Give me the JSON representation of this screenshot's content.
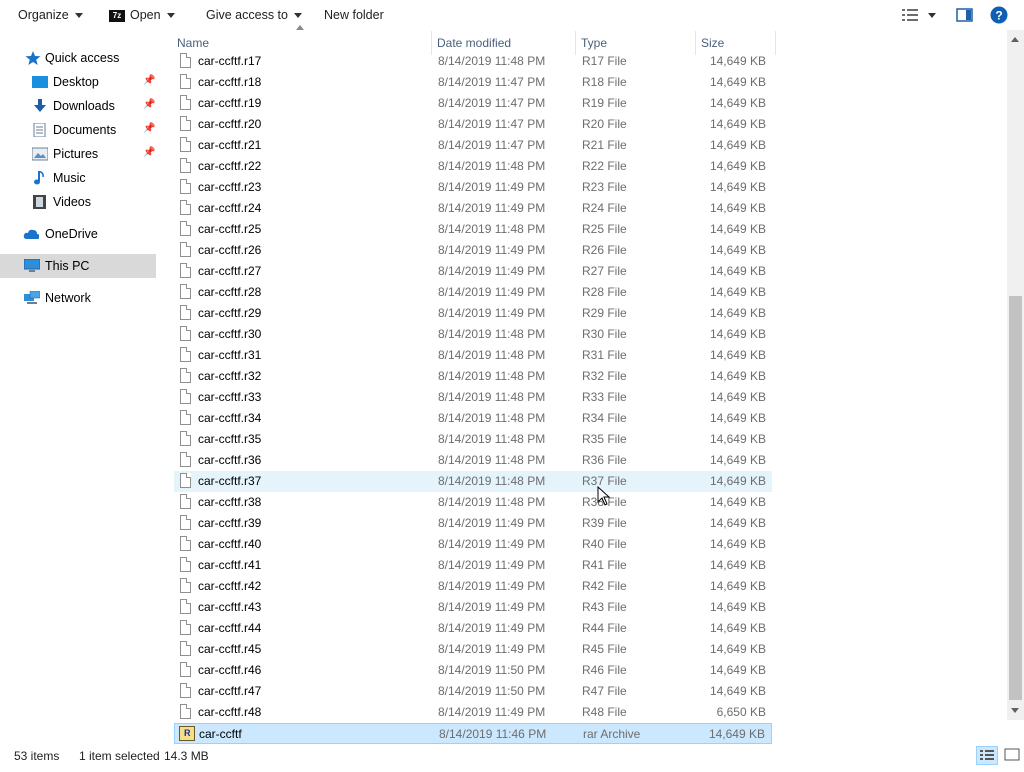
{
  "toolbar": {
    "organize": "Organize",
    "open_badge": "7z",
    "open": "Open",
    "give_access": "Give access to",
    "new_folder": "New folder"
  },
  "nav": {
    "quick_access": "Quick access",
    "items": [
      {
        "label": "Desktop",
        "icon": "desktop-icon"
      },
      {
        "label": "Downloads",
        "icon": "download-icon"
      },
      {
        "label": "Documents",
        "icon": "documents-icon"
      },
      {
        "label": "Pictures",
        "icon": "pictures-icon"
      },
      {
        "label": "Music",
        "icon": "music-icon"
      },
      {
        "label": "Videos",
        "icon": "videos-icon"
      }
    ],
    "onedrive": "OneDrive",
    "this_pc": "This PC",
    "network": "Network"
  },
  "columns": {
    "name": "Name",
    "date": "Date modified",
    "type": "Type",
    "size": "Size"
  },
  "files": [
    {
      "name": "car-ccftf.r17",
      "date": "8/14/2019 11:48 PM",
      "type": "R17 File",
      "size": "14,649 KB"
    },
    {
      "name": "car-ccftf.r18",
      "date": "8/14/2019 11:47 PM",
      "type": "R18 File",
      "size": "14,649 KB"
    },
    {
      "name": "car-ccftf.r19",
      "date": "8/14/2019 11:47 PM",
      "type": "R19 File",
      "size": "14,649 KB"
    },
    {
      "name": "car-ccftf.r20",
      "date": "8/14/2019 11:47 PM",
      "type": "R20 File",
      "size": "14,649 KB"
    },
    {
      "name": "car-ccftf.r21",
      "date": "8/14/2019 11:47 PM",
      "type": "R21 File",
      "size": "14,649 KB"
    },
    {
      "name": "car-ccftf.r22",
      "date": "8/14/2019 11:48 PM",
      "type": "R22 File",
      "size": "14,649 KB"
    },
    {
      "name": "car-ccftf.r23",
      "date": "8/14/2019 11:49 PM",
      "type": "R23 File",
      "size": "14,649 KB"
    },
    {
      "name": "car-ccftf.r24",
      "date": "8/14/2019 11:49 PM",
      "type": "R24 File",
      "size": "14,649 KB"
    },
    {
      "name": "car-ccftf.r25",
      "date": "8/14/2019 11:48 PM",
      "type": "R25 File",
      "size": "14,649 KB"
    },
    {
      "name": "car-ccftf.r26",
      "date": "8/14/2019 11:49 PM",
      "type": "R26 File",
      "size": "14,649 KB"
    },
    {
      "name": "car-ccftf.r27",
      "date": "8/14/2019 11:49 PM",
      "type": "R27 File",
      "size": "14,649 KB"
    },
    {
      "name": "car-ccftf.r28",
      "date": "8/14/2019 11:49 PM",
      "type": "R28 File",
      "size": "14,649 KB"
    },
    {
      "name": "car-ccftf.r29",
      "date": "8/14/2019 11:49 PM",
      "type": "R29 File",
      "size": "14,649 KB"
    },
    {
      "name": "car-ccftf.r30",
      "date": "8/14/2019 11:48 PM",
      "type": "R30 File",
      "size": "14,649 KB"
    },
    {
      "name": "car-ccftf.r31",
      "date": "8/14/2019 11:48 PM",
      "type": "R31 File",
      "size": "14,649 KB"
    },
    {
      "name": "car-ccftf.r32",
      "date": "8/14/2019 11:48 PM",
      "type": "R32 File",
      "size": "14,649 KB"
    },
    {
      "name": "car-ccftf.r33",
      "date": "8/14/2019 11:48 PM",
      "type": "R33 File",
      "size": "14,649 KB"
    },
    {
      "name": "car-ccftf.r34",
      "date": "8/14/2019 11:48 PM",
      "type": "R34 File",
      "size": "14,649 KB"
    },
    {
      "name": "car-ccftf.r35",
      "date": "8/14/2019 11:48 PM",
      "type": "R35 File",
      "size": "14,649 KB"
    },
    {
      "name": "car-ccftf.r36",
      "date": "8/14/2019 11:48 PM",
      "type": "R36 File",
      "size": "14,649 KB"
    },
    {
      "name": "car-ccftf.r37",
      "date": "8/14/2019 11:48 PM",
      "type": "R37 File",
      "size": "14,649 KB"
    },
    {
      "name": "car-ccftf.r38",
      "date": "8/14/2019 11:48 PM",
      "type": "R38 File",
      "size": "14,649 KB"
    },
    {
      "name": "car-ccftf.r39",
      "date": "8/14/2019 11:49 PM",
      "type": "R39 File",
      "size": "14,649 KB"
    },
    {
      "name": "car-ccftf.r40",
      "date": "8/14/2019 11:49 PM",
      "type": "R40 File",
      "size": "14,649 KB"
    },
    {
      "name": "car-ccftf.r41",
      "date": "8/14/2019 11:49 PM",
      "type": "R41 File",
      "size": "14,649 KB"
    },
    {
      "name": "car-ccftf.r42",
      "date": "8/14/2019 11:49 PM",
      "type": "R42 File",
      "size": "14,649 KB"
    },
    {
      "name": "car-ccftf.r43",
      "date": "8/14/2019 11:49 PM",
      "type": "R43 File",
      "size": "14,649 KB"
    },
    {
      "name": "car-ccftf.r44",
      "date": "8/14/2019 11:49 PM",
      "type": "R44 File",
      "size": "14,649 KB"
    },
    {
      "name": "car-ccftf.r45",
      "date": "8/14/2019 11:49 PM",
      "type": "R45 File",
      "size": "14,649 KB"
    },
    {
      "name": "car-ccftf.r46",
      "date": "8/14/2019 11:50 PM",
      "type": "R46 File",
      "size": "14,649 KB"
    },
    {
      "name": "car-ccftf.r47",
      "date": "8/14/2019 11:50 PM",
      "type": "R47 File",
      "size": "14,649 KB"
    },
    {
      "name": "car-ccftf.r48",
      "date": "8/14/2019 11:49 PM",
      "type": "R48 File",
      "size": "6,650 KB"
    },
    {
      "name": "car-ccftf",
      "date": "8/14/2019 11:46 PM",
      "type": "rar Archive",
      "size": "14,649 KB",
      "state": "selected",
      "icon": "rar-archive-icon"
    }
  ],
  "hovered_file": "car-ccftf.r37",
  "status": {
    "item_count": "53 items",
    "selection": "1 item selected",
    "selection_size": "14.3 MB"
  },
  "colors": {
    "selected_bg": "#cce8ff",
    "hover_bg": "#e5f3fb",
    "accent": "#0078d7"
  }
}
